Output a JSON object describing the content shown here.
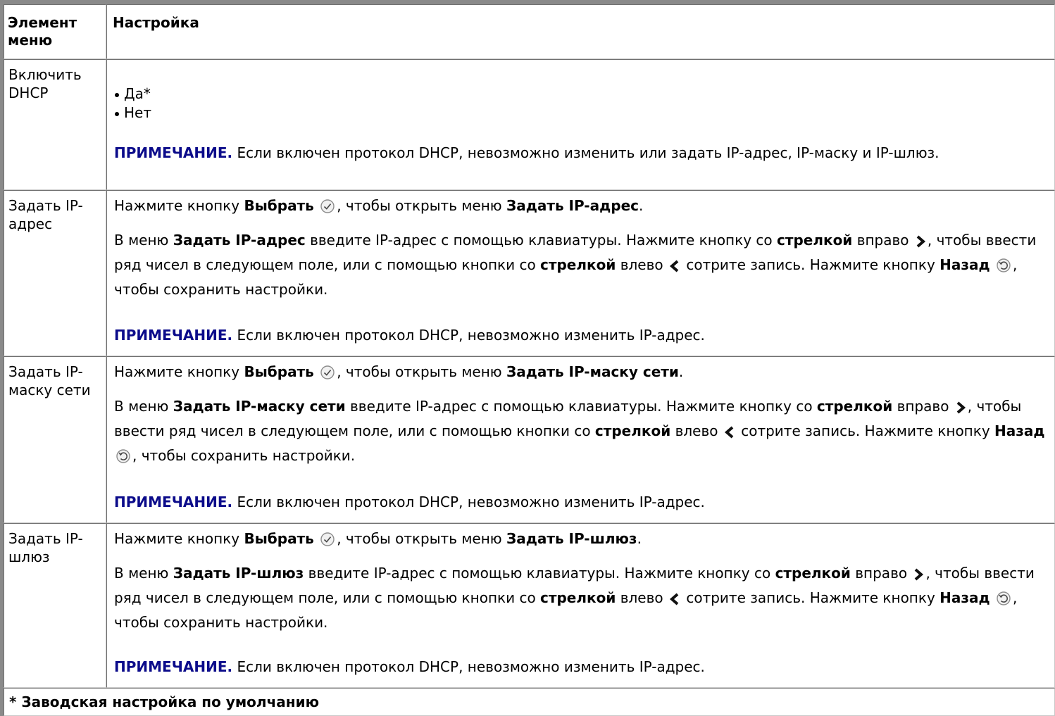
{
  "header": {
    "col1": "Элемент меню",
    "col2": "Настройка"
  },
  "rows": [
    {
      "item": "Включить DHCP",
      "options": [
        "Да*",
        "Нет"
      ],
      "note_label": "ПРИМЕЧАНИЕ.",
      "note_text": "Если включен протокол DHCP, невозможно изменить или задать IP-адрес, IP-маску и IP-шлюз."
    },
    {
      "item": "Задать IP-адрес",
      "line1": {
        "pre": "Нажмите кнопку",
        "btn": "Выбрать",
        "mid": ", чтобы открыть меню",
        "menu": "Задать IP-адрес",
        "end": "."
      },
      "p2": {
        "pre": "В меню",
        "menu": "Задать IP-адрес",
        "a": "введите IP-адрес с помощью клавиатуры. Нажмите кнопку со",
        "arrow1": "стрелкой",
        "b": "вправо",
        "c": ", чтобы ввести ряд чисел в следующем поле, или с помощью кнопки со",
        "arrow2": "стрелкой",
        "d": "влево",
        "e": "сотрите запись. Нажмите кнопку",
        "back": "Назад",
        "f": ", чтобы сохранить настройки."
      },
      "note_label": "ПРИМЕЧАНИЕ.",
      "note_text": "Если включен протокол DHCP, невозможно изменить IP-адрес."
    },
    {
      "item": "Задать IP-маску сети",
      "line1": {
        "pre": "Нажмите кнопку",
        "btn": "Выбрать",
        "mid": ", чтобы открыть меню",
        "menu": "Задать IP-маску сети",
        "end": "."
      },
      "p2": {
        "pre": "В меню",
        "menu": "Задать IP-маску сети",
        "a": "введите IP-адрес с помощью клавиатуры. Нажмите кнопку со",
        "arrow1": "стрелкой",
        "b": "вправо",
        "c": ", чтобы ввести ряд чисел в следующем поле, или с помощью кнопки со",
        "arrow2": "стрелкой",
        "d": "влево",
        "e": "сотрите запись. Нажмите кнопку",
        "back": "Назад",
        "f": ", чтобы сохранить настройки."
      },
      "note_label": "ПРИМЕЧАНИЕ.",
      "note_text": "Если включен протокол DHCP, невозможно изменить IP-адрес."
    },
    {
      "item": "Задать IP-шлюз",
      "line1": {
        "pre": "Нажмите кнопку",
        "btn": "Выбрать",
        "mid": ", чтобы открыть меню",
        "menu": "Задать IP-шлюз",
        "end": "."
      },
      "p2": {
        "pre": "В меню",
        "menu": "Задать IP-шлюз",
        "a": "введите IP-адрес с помощью клавиатуры. Нажмите кнопку со",
        "arrow1": "стрелкой",
        "b": "вправо",
        "c": ", чтобы ввести ряд чисел в следующем поле, или с помощью кнопки со",
        "arrow2": "стрелкой",
        "d": "влево",
        "e": "сотрите запись. Нажмите кнопку",
        "back": "Назад",
        "f": ", чтобы сохранить настройки."
      },
      "note_label": "ПРИМЕЧАНИЕ.",
      "note_text": "Если включен протокол DHCP, невозможно изменить IP-адрес."
    }
  ],
  "footer": "* Заводская настройка по умолчанию",
  "icons": {
    "select": "select-button-icon",
    "back": "back-button-icon",
    "right": "right-arrow-icon",
    "left": "left-arrow-icon"
  }
}
